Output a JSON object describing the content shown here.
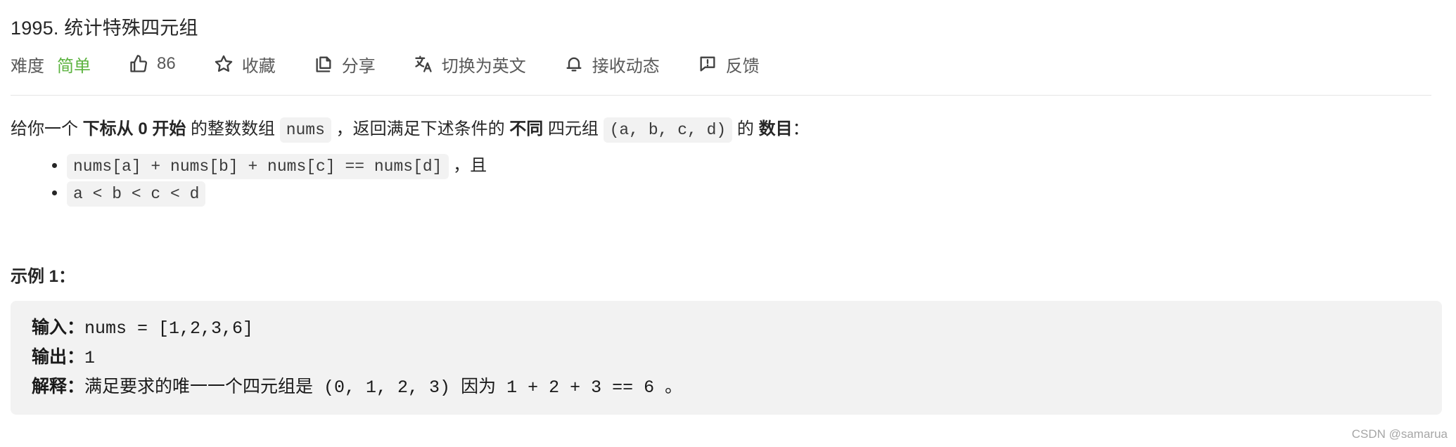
{
  "problem": {
    "title": "1995. 统计特殊四元组"
  },
  "meta": {
    "difficulty_label": "难度",
    "difficulty_value": "简单",
    "like_count": "86",
    "favorite_label": "收藏",
    "share_label": "分享",
    "translate_label": "切换为英文",
    "subscribe_label": "接收动态",
    "feedback_label": "反馈",
    "difficulty_color": "#5cb340"
  },
  "description": {
    "part1": "给你一个 ",
    "bold1": "下标从 0 开始",
    "part2": " 的整数数组 ",
    "code1": "nums",
    "part3": " ，返回满足下述条件的 ",
    "bold2": "不同",
    "part4": " 四元组 ",
    "code2": "(a, b, c, d)",
    "part5": " 的 ",
    "bold3": "数目",
    "part6": "：",
    "conditions": [
      {
        "code": "nums[a] + nums[b] + nums[c] == nums[d]",
        "suffix": " ，且"
      },
      {
        "code": "a < b < c < d",
        "suffix": ""
      }
    ]
  },
  "example": {
    "title": "示例 1：",
    "input_label": "输入：",
    "input_value": "nums = [1,2,3,6]",
    "output_label": "输出：",
    "output_value": "1",
    "explain_label": "解释：",
    "explain_zh1": "满足要求的唯一一个四元组是",
    "explain_code1": " (0, 1, 2, 3) ",
    "explain_zh2": "因为",
    "explain_code2": " 1 + 2 + 3 == 6 ",
    "explain_end": "。"
  },
  "watermark": "CSDN @samarua"
}
